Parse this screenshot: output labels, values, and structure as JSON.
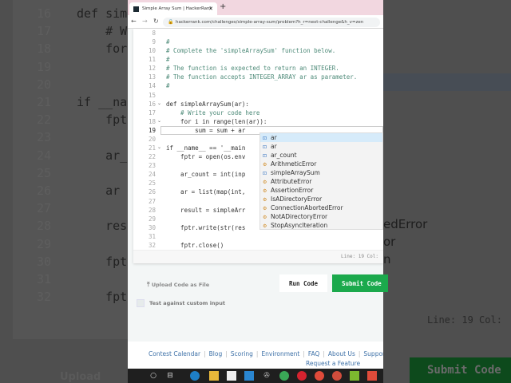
{
  "browser": {
    "tab_title": "Simple Array Sum | HackerRank",
    "url": "hackerrank.com/challenges/simple-array-sum/problem?h_r=next-challenge&h_v=zen"
  },
  "editor": {
    "lines": [
      {
        "n": "8",
        "text": ""
      },
      {
        "n": "9",
        "text": "#"
      },
      {
        "n": "10",
        "text": "# Complete the 'simpleArraySum' function below."
      },
      {
        "n": "11",
        "text": "#"
      },
      {
        "n": "12",
        "text": "# The function is expected to return an INTEGER."
      },
      {
        "n": "13",
        "text": "# The function accepts INTEGER_ARRAY ar as parameter."
      },
      {
        "n": "14",
        "text": "#"
      },
      {
        "n": "15",
        "text": ""
      },
      {
        "n": "16",
        "text": "def simpleArraySum(ar):"
      },
      {
        "n": "17",
        "text": "    # Write your code here"
      },
      {
        "n": "18",
        "text": "    for i in range(len(ar)):"
      },
      {
        "n": "19",
        "text": "        sum = sum + ar"
      },
      {
        "n": "20",
        "text": ""
      },
      {
        "n": "21",
        "text": "if __name__ == '__main"
      },
      {
        "n": "22",
        "text": "    fptr = open(os.env"
      },
      {
        "n": "23",
        "text": ""
      },
      {
        "n": "24",
        "text": "    ar_count = int(inp"
      },
      {
        "n": "25",
        "text": ""
      },
      {
        "n": "26",
        "text": "    ar = list(map(int,"
      },
      {
        "n": "27",
        "text": ""
      },
      {
        "n": "28",
        "text": "    result = simpleArr"
      },
      {
        "n": "29",
        "text": ""
      },
      {
        "n": "30",
        "text": "    fptr.write(str(res"
      },
      {
        "n": "31",
        "text": ""
      },
      {
        "n": "32",
        "text": "    fptr.close()"
      }
    ],
    "autocomplete": [
      {
        "label": "ar",
        "kind": "variable"
      },
      {
        "label": "ar",
        "kind": "variable"
      },
      {
        "label": "ar_count",
        "kind": "variable"
      },
      {
        "label": "ArithmeticError",
        "kind": "class"
      },
      {
        "label": "simpleArraySum",
        "kind": "variable"
      },
      {
        "label": "AttributeError",
        "kind": "class"
      },
      {
        "label": "AssertionError",
        "kind": "class"
      },
      {
        "label": "IsADirectoryError",
        "kind": "class"
      },
      {
        "label": "ConnectionAbortedError",
        "kind": "class"
      },
      {
        "label": "NotADirectoryError",
        "kind": "class"
      },
      {
        "label": "StopAsyncIteration",
        "kind": "class"
      }
    ],
    "status": "Line: 19 Col:"
  },
  "actions": {
    "upload": "Upload Code as File",
    "run": "Run Code",
    "submit": "Submit Code",
    "custom_input": "Test against custom input"
  },
  "footer": {
    "links": [
      "Contest Calendar",
      "Blog",
      "Scoring",
      "Environment",
      "FAQ",
      "About Us",
      "Support"
    ],
    "request": "Request a Feature"
  },
  "background": {
    "left_lines": [
      {
        "n": "16",
        "t": "def sim"
      },
      {
        "n": "17",
        "t": "    # W"
      },
      {
        "n": "18",
        "t": "    for"
      },
      {
        "n": "19",
        "t": ""
      },
      {
        "n": "20",
        "t": ""
      },
      {
        "n": "21",
        "t": "if __na"
      },
      {
        "n": "22",
        "t": "    fpt"
      },
      {
        "n": "23",
        "t": ""
      },
      {
        "n": "24",
        "t": "    ar_"
      },
      {
        "n": "25",
        "t": ""
      },
      {
        "n": "26",
        "t": "    ar "
      },
      {
        "n": "27",
        "t": ""
      },
      {
        "n": "28",
        "t": "    res"
      },
      {
        "n": "29",
        "t": ""
      },
      {
        "n": "30",
        "t": "    fpt"
      },
      {
        "n": "31",
        "t": ""
      },
      {
        "n": "32",
        "t": "    fpt"
      }
    ],
    "left_upload": "Upload Code",
    "right_items": [
      "edError",
      "or",
      "n"
    ],
    "right_status": "Line: 19 Col:",
    "right_submit": "Submit Code"
  },
  "colors": {
    "submit": "#1ba94c",
    "link": "#3f72a8",
    "selection": "#d6ebfa"
  }
}
